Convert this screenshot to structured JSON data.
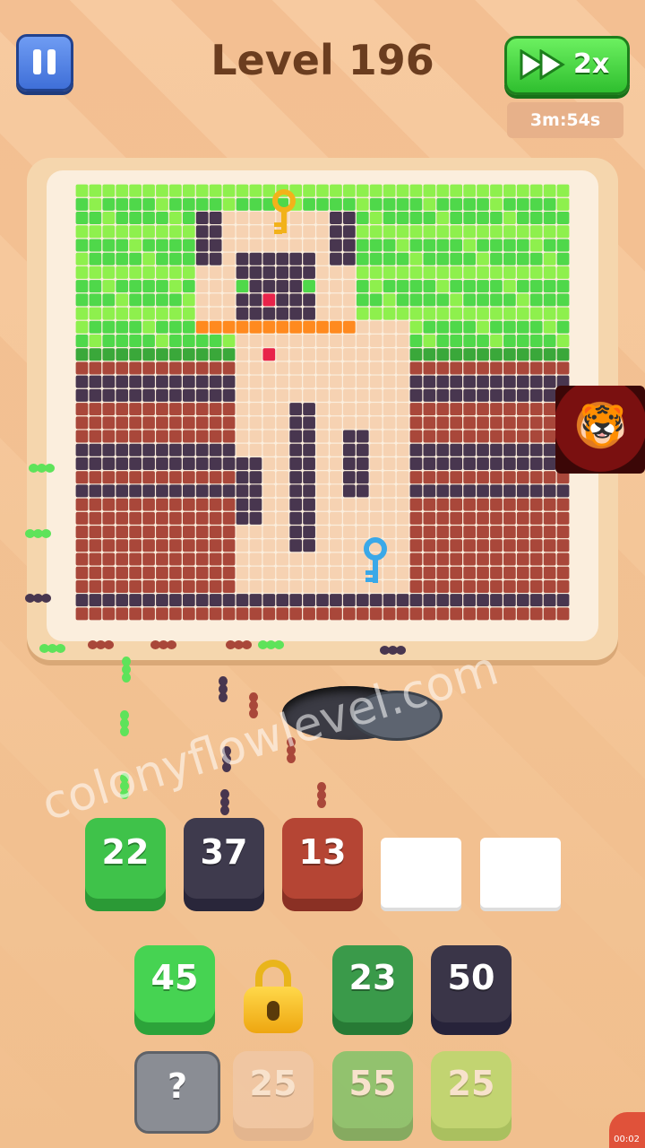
{
  "header": {
    "level_title": "Level 196",
    "speed_label": "2x",
    "timer": "3m:54s"
  },
  "watermark": "colonyflowlevel.com",
  "colors": {
    "grass_light": "#8ef04d",
    "grass_dark": "#4fd84a",
    "soil_brown": "#a9473a",
    "soil_dark": "#48364f",
    "cat_cream": "#f6d2b2",
    "collar_orange": "#ff8a1f",
    "nose_red": "#e8234a"
  },
  "queue_slots": [
    {
      "value": "22",
      "color": "#3fc24a",
      "base": "#2b9a36"
    },
    {
      "value": "37",
      "color": "#3e3a4d",
      "base": "#29263a"
    },
    {
      "value": "13",
      "color": "#b54534",
      "base": "#8a3024"
    },
    {
      "value": "",
      "empty": true
    },
    {
      "value": "",
      "empty": true
    }
  ],
  "colonies_row1": [
    {
      "value": "45",
      "color": "#46d352",
      "base": "#2ca33a"
    },
    {
      "value": "locked",
      "lock": true
    },
    {
      "value": "23",
      "color": "#3a9a4a",
      "base": "#277a35"
    },
    {
      "value": "50",
      "color": "#3a3548",
      "base": "#27233a"
    }
  ],
  "colonies_row2": [
    {
      "value": "?",
      "color": "#8a8d94"
    },
    {
      "value": "25",
      "color": "#f0cdb2",
      "base": "#d8ae8f"
    },
    {
      "value": "55",
      "color": "#46c454",
      "base": "#2f9a3c"
    },
    {
      "value": "25",
      "color": "#9ce65a",
      "base": "#71c13a"
    }
  ],
  "recording": {
    "time": "00:02"
  }
}
